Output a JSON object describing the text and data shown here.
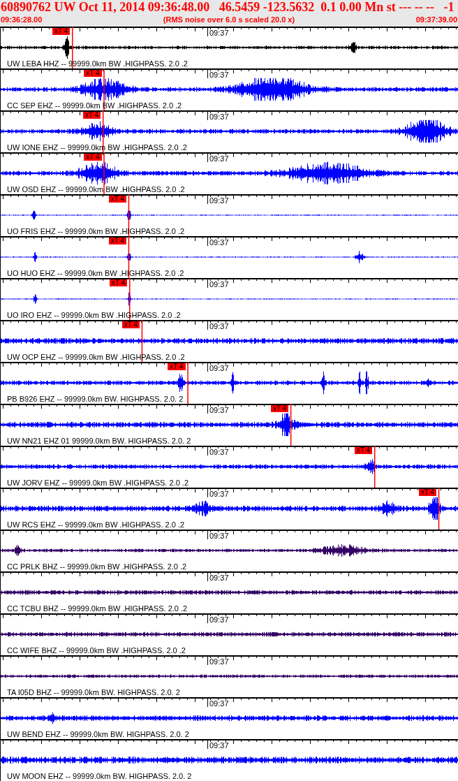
{
  "header": {
    "event": "60890762 UW Oct 11, 2014 09:36:48.00   46.5459 -123.5632  0.1 0.00 Mn st --- -- --   -1",
    "start_time": "09:36:28.00",
    "note": "(RMS noise over 6.0 s scaled 20.0 x)",
    "end_time": "09:37:39.00"
  },
  "traces": [
    {
      "label": "UW LEBA HHZ -- 99999.0km BW .HIGHPASS. 2.0 .2",
      "time_label": "09:37",
      "color": "#000000",
      "pick": {
        "label": "xT 4",
        "level": 0.157
      }
    },
    {
      "label": "CC SEP EHZ -- 99999.0km BW .HIGHPASS. 2.0 .2",
      "time_label": "09:37",
      "color": "#0000ff",
      "pick": {
        "label": "xT 4",
        "level": 0.226
      }
    },
    {
      "label": "UW IONE EHZ -- 99999.0km BW .HIGHPASS. 2.0 .2",
      "time_label": "09:37",
      "color": "#0000ff",
      "pick": {
        "label": "xT 4",
        "level": 0.224
      }
    },
    {
      "label": "UW OSD EHZ -- 99999.0km BW .HIGHPASS. 2.0 .2",
      "time_label": "09:37",
      "color": "#0000ff",
      "pick": {
        "label": "xT 4",
        "level": 0.226
      }
    },
    {
      "label": "UO FRIS EHZ -- 99999.0km BW .HIGHPASS. 2.0 .2",
      "time_label": "09:37",
      "color": "#0000ff",
      "pick": {
        "label": "xT 4",
        "level": 0.28
      }
    },
    {
      "label": "UO HUO EHZ -- 99999.0km BW .HIGHPASS. 2.0 .2",
      "time_label": "09:37",
      "color": "#0000ff",
      "pick": {
        "label": "xT 4",
        "level": 0.28
      }
    },
    {
      "label": "UO IRO EHZ -- 99999.0km BW .HIGHPASS. 2.0 .2",
      "time_label": "09:37",
      "color": "#0000ff",
      "pick": {
        "label": "xT 4",
        "level": 0.282
      }
    },
    {
      "label": "UW OCP EHZ -- 99999.0km BW .HIGHPASS. 2.0 .2",
      "time_label": "09:37",
      "color": "#0000ff",
      "pick": {
        "label": "xT 4",
        "level": 0.309
      }
    },
    {
      "label": "PB B926 EHZ -- 99999.0km BW. HIGHPASS. 2.0. 2",
      "time_label": "09:37",
      "color": "#0000ff",
      "pick": {
        "label": "xT 4",
        "level": 0.409
      }
    },
    {
      "label": "UW NN21 EHZ 01 99999.0km BW. HIGHPASS. 2.0. 2",
      "time_label": "09:37",
      "color": "#0000ff",
      "pick": {
        "label": "xT 4",
        "level": 0.634
      }
    },
    {
      "label": "UW JORV EHZ -- 99999.0km BW .HIGHPASS. 2.0 .2",
      "time_label": "09:37",
      "color": "#0000ff",
      "pick": {
        "label": "xT 4",
        "level": 0.817
      }
    },
    {
      "label": "UW RCS EHZ -- 99999.0km BW .HIGHPASS. 2.0 .2",
      "time_label": "09:37",
      "color": "#0000ff",
      "pick": {
        "label": "xT 4",
        "level": 0.957
      }
    },
    {
      "label": "CC PRLK BHZ -- 99999.0km BW .HIGHPASS. 2.0 .2",
      "time_label": "09:37",
      "color": "#330066"
    },
    {
      "label": "CC TCBU BHZ -- 99999.0km BW .HIGHPASS. 2.0 .2",
      "time_label": "09:37",
      "color": "#330066"
    },
    {
      "label": "CC WIFE BHZ -- 99999.0km BW .HIGHPASS. 2.0 .2",
      "time_label": "09:37",
      "color": "#330066"
    },
    {
      "label": "TA I05D BHZ -- 99999.0km BW. HIGHPASS. 2.0. 2",
      "time_label": "09:37",
      "color": "#330066"
    },
    {
      "label": "UW BEND EHZ -- 99999.0km BW. HIGHPASS. 2.0. 2",
      "time_label": "09:37",
      "color": "#0000ff"
    },
    {
      "label": "UW MOON EHZ -- 99999.0km BW. HIGHPASS. 2.0. 2",
      "time_label": "09:37",
      "color": "#0000ff"
    }
  ]
}
